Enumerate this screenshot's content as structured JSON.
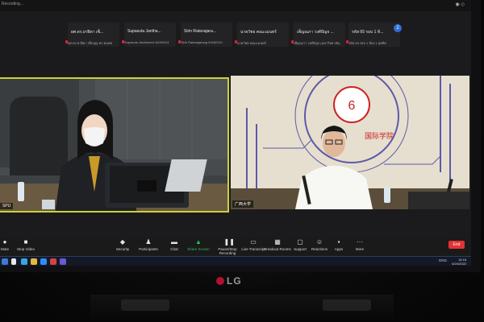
{
  "window": {
    "title": "Recording...",
    "rec_label": "◉ ◇"
  },
  "participants_strip": [
    {
      "name": "ผศ.ดร.ยาฝิดา เซ็...",
      "sub": "ผศ.ดร.ยาฝิดา เซ็บบุญ ทร.ทนทท"
    },
    {
      "name": "Supasuta Jantha...",
      "sub": "Supasuta Janthachot 64160111"
    },
    {
      "name": "Sirin Ratanajara...",
      "sub": "Sirin Ratanajarang 64160110"
    },
    {
      "name": "นายวัชธ คณะเมนทร์",
      "sub": "นายวัชธ คณะเมนทร์"
    },
    {
      "name": "เพ็ญณภา วงศ์ปัญจ ...",
      "sub": "เพ็ญณภา วงศ์ปัญจ (มหาวิทยาลัย)"
    },
    {
      "name": "รหัส 65 รอบ 1 ห้...",
      "sub": "รหัส 65 รอบ 1 ห้อง 1 ยุทธิศ"
    }
  ],
  "strip_badge": "2",
  "videos": {
    "left_name": "SPU",
    "right_name": "广西大学",
    "right_banner_text": "国际学院"
  },
  "toolbar": {
    "items": [
      {
        "label": "Mute",
        "icon": "mic-icon"
      },
      {
        "label": "Stop Video",
        "icon": "video-icon"
      },
      {
        "label": "Security",
        "icon": "shield-icon"
      },
      {
        "label": "Participants",
        "icon": "people-icon",
        "count": "42"
      },
      {
        "label": "Chat",
        "icon": "chat-icon"
      },
      {
        "label": "Share Screen",
        "icon": "share-icon"
      },
      {
        "label": "Pause/Stop Recording",
        "icon": "record-icon"
      },
      {
        "label": "Live Transcript",
        "icon": "cc-icon"
      },
      {
        "label": "Breakout Rooms",
        "icon": "grid-icon"
      },
      {
        "label": "Support",
        "icon": "support-icon"
      },
      {
        "label": "Reactions",
        "icon": "smile-icon"
      },
      {
        "label": "Apps",
        "icon": "apps-icon"
      },
      {
        "label": "More",
        "icon": "more-icon"
      }
    ],
    "end_label": "End"
  },
  "taskbar": {
    "tray_text": "ENG",
    "time": "16:18",
    "date": "6/24/2022"
  },
  "monitor": {
    "brand": "LG"
  },
  "colors": {
    "accent": "#c8d23a",
    "end": "#e23333",
    "share": "#2dbd5a"
  }
}
